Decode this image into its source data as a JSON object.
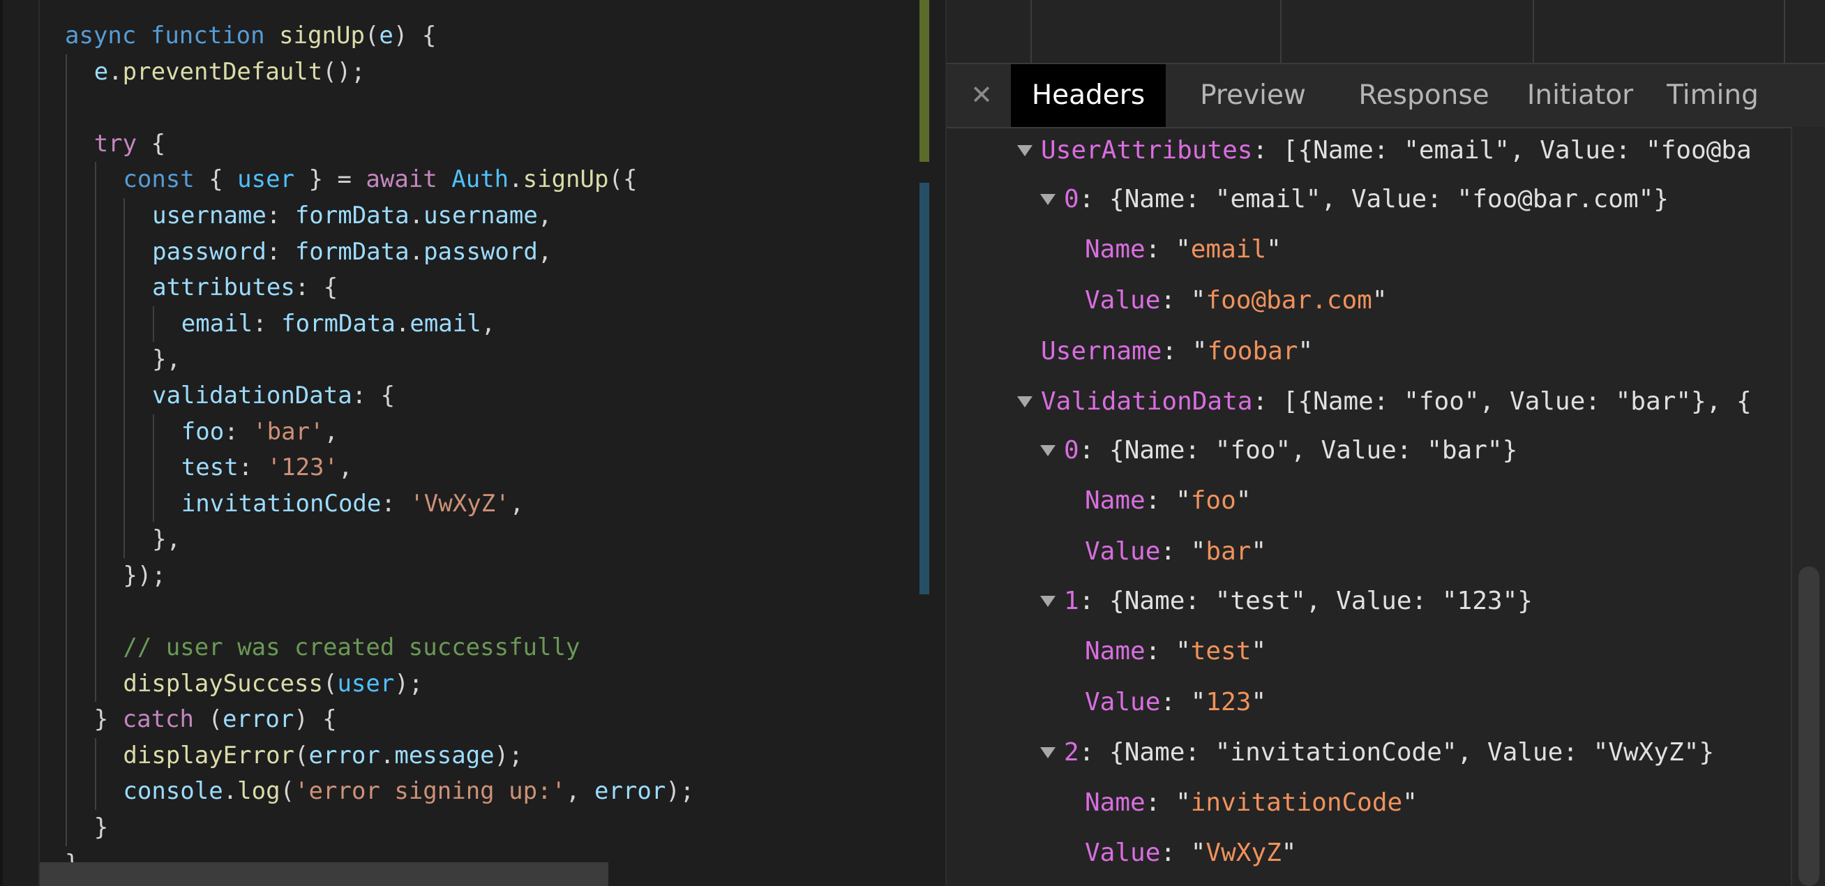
{
  "editor": {
    "code": [
      {
        "indent": 0,
        "tokens": [
          [
            "kw",
            "async"
          ],
          [
            "pun",
            " "
          ],
          [
            "kw",
            "function"
          ],
          [
            "pun",
            " "
          ],
          [
            "fn",
            "signUp"
          ],
          [
            "pun",
            "("
          ],
          [
            "var",
            "e"
          ],
          [
            "pun",
            ") {"
          ]
        ]
      },
      {
        "indent": 1,
        "tokens": [
          [
            "var",
            "e"
          ],
          [
            "pun",
            "."
          ],
          [
            "fn",
            "preventDefault"
          ],
          [
            "pun",
            "();"
          ]
        ]
      },
      {
        "indent": 1,
        "tokens": []
      },
      {
        "indent": 1,
        "tokens": [
          [
            "ctl",
            "try"
          ],
          [
            "pun",
            " {"
          ]
        ]
      },
      {
        "indent": 2,
        "tokens": [
          [
            "kw",
            "const"
          ],
          [
            "pun",
            " { "
          ],
          [
            "vb",
            "user"
          ],
          [
            "pun",
            " } = "
          ],
          [
            "ctl",
            "await"
          ],
          [
            "pun",
            " "
          ],
          [
            "vb",
            "Auth"
          ],
          [
            "pun",
            "."
          ],
          [
            "fn",
            "signUp"
          ],
          [
            "pun",
            "({"
          ]
        ]
      },
      {
        "indent": 3,
        "tokens": [
          [
            "prop",
            "username"
          ],
          [
            "pun",
            ": "
          ],
          [
            "var",
            "formData"
          ],
          [
            "pun",
            "."
          ],
          [
            "prop",
            "username"
          ],
          [
            "pun",
            ","
          ]
        ]
      },
      {
        "indent": 3,
        "tokens": [
          [
            "prop",
            "password"
          ],
          [
            "pun",
            ": "
          ],
          [
            "var",
            "formData"
          ],
          [
            "pun",
            "."
          ],
          [
            "prop",
            "password"
          ],
          [
            "pun",
            ","
          ]
        ]
      },
      {
        "indent": 3,
        "tokens": [
          [
            "prop",
            "attributes"
          ],
          [
            "pun",
            ": {"
          ]
        ]
      },
      {
        "indent": 4,
        "tokens": [
          [
            "prop",
            "email"
          ],
          [
            "pun",
            ": "
          ],
          [
            "var",
            "formData"
          ],
          [
            "pun",
            "."
          ],
          [
            "prop",
            "email"
          ],
          [
            "pun",
            ","
          ]
        ]
      },
      {
        "indent": 3,
        "tokens": [
          [
            "pun",
            "},"
          ]
        ]
      },
      {
        "indent": 3,
        "tokens": [
          [
            "prop",
            "validationData"
          ],
          [
            "pun",
            ": {"
          ]
        ]
      },
      {
        "indent": 4,
        "tokens": [
          [
            "prop",
            "foo"
          ],
          [
            "pun",
            ": "
          ],
          [
            "str",
            "'bar'"
          ],
          [
            "pun",
            ","
          ]
        ]
      },
      {
        "indent": 4,
        "tokens": [
          [
            "prop",
            "test"
          ],
          [
            "pun",
            ": "
          ],
          [
            "str",
            "'123'"
          ],
          [
            "pun",
            ","
          ]
        ]
      },
      {
        "indent": 4,
        "tokens": [
          [
            "prop",
            "invitationCode"
          ],
          [
            "pun",
            ": "
          ],
          [
            "str",
            "'VwXyZ'"
          ],
          [
            "pun",
            ","
          ]
        ]
      },
      {
        "indent": 3,
        "tokens": [
          [
            "pun",
            "},"
          ]
        ]
      },
      {
        "indent": 2,
        "tokens": [
          [
            "pun",
            "});"
          ]
        ]
      },
      {
        "indent": 2,
        "tokens": []
      },
      {
        "indent": 2,
        "tokens": [
          [
            "com",
            "// user was created successfully"
          ]
        ]
      },
      {
        "indent": 2,
        "tokens": [
          [
            "fn",
            "displaySuccess"
          ],
          [
            "pun",
            "("
          ],
          [
            "vb",
            "user"
          ],
          [
            "pun",
            ");"
          ]
        ]
      },
      {
        "indent": 1,
        "tokens": [
          [
            "pun",
            "} "
          ],
          [
            "ctl",
            "catch"
          ],
          [
            "pun",
            " ("
          ],
          [
            "var",
            "error"
          ],
          [
            "pun",
            ") {"
          ]
        ]
      },
      {
        "indent": 2,
        "tokens": [
          [
            "fn",
            "displayError"
          ],
          [
            "pun",
            "("
          ],
          [
            "var",
            "error"
          ],
          [
            "pun",
            "."
          ],
          [
            "prop",
            "message"
          ],
          [
            "pun",
            ");"
          ]
        ]
      },
      {
        "indent": 2,
        "tokens": [
          [
            "var",
            "console"
          ],
          [
            "pun",
            "."
          ],
          [
            "fn",
            "log"
          ],
          [
            "pun",
            "("
          ],
          [
            "str",
            "'error signing up:'"
          ],
          [
            "pun",
            ", "
          ],
          [
            "var",
            "error"
          ],
          [
            "pun",
            ");"
          ]
        ]
      },
      {
        "indent": 1,
        "tokens": [
          [
            "pun",
            "}"
          ]
        ]
      },
      {
        "indent": 0,
        "tokens": [
          [
            "pun",
            "}"
          ]
        ]
      }
    ]
  },
  "devtools": {
    "close_icon": "close-icon",
    "tabs": [
      {
        "label": "Headers",
        "active": true
      },
      {
        "label": "Preview",
        "active": false
      },
      {
        "label": "Response",
        "active": false
      },
      {
        "label": "Initiator",
        "active": false
      },
      {
        "label": "Timing",
        "active": false
      }
    ],
    "tree": [
      {
        "level": 0,
        "expanded": true,
        "key": "UserAttributes",
        "key_style": "k",
        "summary": "[{Name: \"email\", Value: \"foo@ba"
      },
      {
        "level": 1,
        "expanded": true,
        "key": "0",
        "key_style": "ki",
        "summary": "{Name: \"email\", Value: \"foo@bar.com\"}"
      },
      {
        "level": 2,
        "key": "Name",
        "key_style": "k",
        "value": "email"
      },
      {
        "level": 2,
        "key": "Value",
        "key_style": "k",
        "value": "foo@bar.com"
      },
      {
        "level": 0,
        "key": "Username",
        "key_style": "k",
        "value": "foobar"
      },
      {
        "level": 0,
        "expanded": true,
        "key": "ValidationData",
        "key_style": "k",
        "summary": "[{Name: \"foo\", Value: \"bar\"}, {"
      },
      {
        "level": 1,
        "expanded": true,
        "key": "0",
        "key_style": "ki",
        "summary": "{Name: \"foo\", Value: \"bar\"}"
      },
      {
        "level": 2,
        "key": "Name",
        "key_style": "k",
        "value": "foo"
      },
      {
        "level": 2,
        "key": "Value",
        "key_style": "k",
        "value": "bar"
      },
      {
        "level": 1,
        "expanded": true,
        "key": "1",
        "key_style": "ki",
        "summary": "{Name: \"test\", Value: \"123\"}"
      },
      {
        "level": 2,
        "key": "Name",
        "key_style": "k",
        "value": "test"
      },
      {
        "level": 2,
        "key": "Value",
        "key_style": "k",
        "value": "123"
      },
      {
        "level": 1,
        "expanded": true,
        "key": "2",
        "key_style": "ki",
        "summary": "{Name: \"invitationCode\", Value: \"VwXyZ\"}"
      },
      {
        "level": 2,
        "key": "Name",
        "key_style": "k",
        "value": "invitationCode"
      },
      {
        "level": 2,
        "key": "Value",
        "key_style": "k",
        "value": "VwXyZ"
      }
    ]
  }
}
